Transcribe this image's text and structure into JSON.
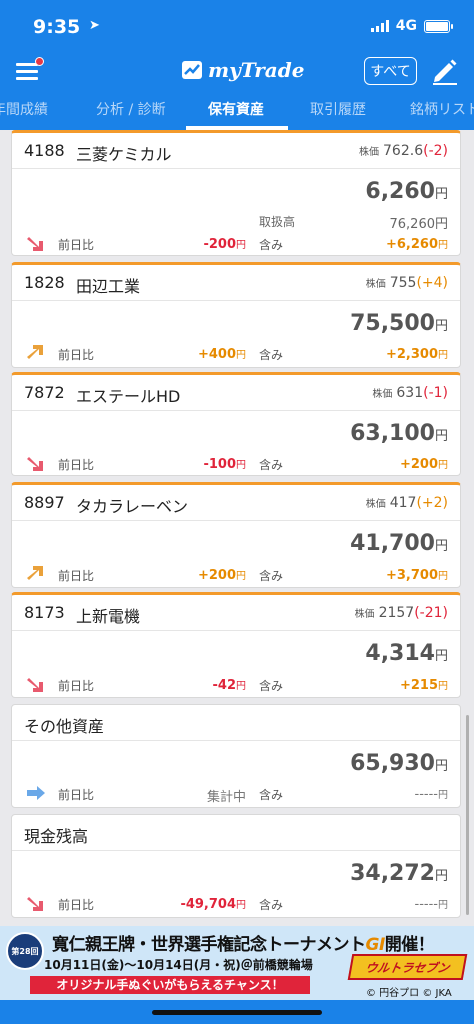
{
  "status": {
    "time": "9:35",
    "network": "4G"
  },
  "app": {
    "title": "myTrade",
    "all_button": "すべて"
  },
  "tabs": [
    {
      "label": "年間成績"
    },
    {
      "label": "分析 / 診断"
    },
    {
      "label": "保有資産"
    },
    {
      "label": "取引履歴"
    },
    {
      "label": "銘柄リスト"
    }
  ],
  "active_tab": "保有資産",
  "labels": {
    "price_label": "株価",
    "prev_day": "前日比",
    "fukumi": "含み",
    "volume": "取扱高",
    "yen": "円"
  },
  "holdings": [
    {
      "code": "4188",
      "name": "三菱ケミカル",
      "price": "762.6",
      "price_change": "(-2)",
      "trend": "down",
      "value": "6,260",
      "volume": "76,260円",
      "prev_diff": "-200",
      "fukumi": "+6,260"
    },
    {
      "code": "1828",
      "name": "田辺工業",
      "price": "755",
      "price_change": "(+4)",
      "trend": "up",
      "value": "75,500",
      "prev_diff": "+400",
      "fukumi": "+2,300"
    },
    {
      "code": "7872",
      "name": "エステールHD",
      "price": "631",
      "price_change": "(-1)",
      "trend": "down",
      "value": "63,100",
      "prev_diff": "-100",
      "fukumi": "+200"
    },
    {
      "code": "8897",
      "name": "タカラレーベン",
      "price": "417",
      "price_change": "(+2)",
      "trend": "up",
      "value": "41,700",
      "prev_diff": "+200",
      "fukumi": "+3,700"
    },
    {
      "code": "8173",
      "name": "上新電機",
      "price": "2157",
      "price_change": "(-21)",
      "trend": "down",
      "value": "4,314",
      "prev_diff": "-42",
      "fukumi": "+215"
    }
  ],
  "other_assets": {
    "title": "その他資産",
    "value": "65,930",
    "prev_diff": "集計中",
    "fukumi": "-----"
  },
  "cash": {
    "title": "現金残高",
    "value": "34,272",
    "prev_diff": "-49,704",
    "fukumi": "-----"
  },
  "banner": {
    "badge": "第28回",
    "title": "寬仁親王牌・世界選手権記念トーナメント",
    "grade": "GI",
    "title_suffix": "開催！",
    "dates": "10月11日(金)〜10月14日(月・祝)＠前橋競輪場",
    "promo": "オリジナル手ぬぐいがもらえるチャンス！",
    "logo_text": "ウルトラセブン",
    "copyright": "© 円谷プロ © JKA"
  },
  "colors": {
    "primary": "#1a82e8",
    "accent_orange": "#f39a2b",
    "down_red": "#e0243a",
    "up_orange": "#e68a00"
  }
}
